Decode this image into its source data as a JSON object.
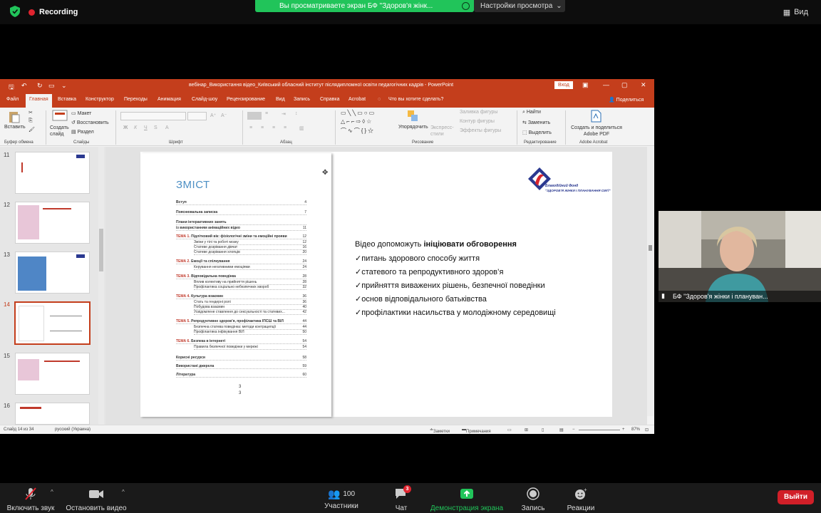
{
  "zoom": {
    "recording_label": "Recording",
    "share_banner": "Вы просматриваете экран БФ \"Здоров'я жінк...",
    "view_options": "Настройки просмотра",
    "view_button": "Вид"
  },
  "ppt": {
    "window_title": "вебінар_Використання відео_Київський обласний інститут післядипломної освіти педагогічних кадрів  -  PowerPoint",
    "signin": "Вход",
    "tabs": [
      "Файл",
      "Главная",
      "Вставка",
      "Конструктор",
      "Переходы",
      "Анимация",
      "Слайд-шоу",
      "Рецензирование",
      "Вид",
      "Запись",
      "Справка",
      "Acrobat"
    ],
    "tell_me": "Что вы хотите сделать?",
    "share": "Поделиться",
    "ribbon": {
      "paste": "Вставить",
      "new_slide": "Создать слайд",
      "layout": "Макет",
      "reset": "Восстановить",
      "section": "Раздел",
      "arrange": "Упорядочить",
      "quick_styles": "Экспресс-стили",
      "shape_fill": "Заливка фигуры",
      "shape_outline": "Контур фигуры",
      "shape_effects": "Эффекты фигуры",
      "find": "Найти",
      "replace": "Заменить",
      "select": "Выделить",
      "adobe": "Создать и поделиться Adobe PDF",
      "groups": [
        "Буфер обмена",
        "Слайды",
        "Шрифт",
        "Абзац",
        "Рисование",
        "Редактирование",
        "Adobe Acrobat"
      ]
    },
    "thumb_numbers": [
      "11",
      "12",
      "13",
      "14",
      "15",
      "16"
    ],
    "slide": {
      "toc_title": "ЗМІСТ",
      "toc": [
        {
          "label": "Вступ",
          "page": "4"
        },
        {
          "label": "Пояснювальна записка",
          "page": "7"
        },
        {
          "label": "Плани інтерактивних занять",
          "page": ""
        },
        {
          "label": "із використанням анімаційних відео",
          "page": "11"
        }
      ],
      "topics": [
        {
          "tema": "ТЕМА 1.",
          "title": "Підлітковий вік: фізіологічні зміни та емоційні прояви",
          "page": "12",
          "subs": [
            [
              "Зміни у тілі та роботі мозку",
              "12"
            ],
            [
              "Статеве дозрівання дівчат",
              "16"
            ],
            [
              "Статеве дозрівання хлопців",
              "20"
            ]
          ]
        },
        {
          "tema": "ТЕМА 2.",
          "title": "Емоції та спілкування",
          "page": "24",
          "subs": [
            [
              "Керування негативними емоціями",
              "24"
            ]
          ]
        },
        {
          "tema": "ТЕМА 3.",
          "title": "Відповідальна поведінка",
          "page": "28",
          "subs": [
            [
              "Вплив колективу на прийняття рішень",
              "28"
            ],
            [
              "Профілактика соціально небезпечних хвороб",
              "32"
            ]
          ]
        },
        {
          "tema": "ТЕМА 4.",
          "title": "Культура взаємин",
          "page": "36",
          "subs": [
            [
              "Стать та гендерні ролі",
              "36"
            ],
            [
              "Побудова взаємин",
              "40"
            ],
            [
              "Усвідомлене ставлення до сексуальності та статевих...",
              "42"
            ]
          ]
        },
        {
          "tema": "ТЕМА 5.",
          "title": "Репродуктивне здоров'я, профілактика ІПСШ та ВІЛ",
          "page": "44",
          "subs": [
            [
              "Безпечна статева поведінка: методи контрацепції",
              "44"
            ],
            [
              "Профілактика інфікування ВІЛ",
              "50"
            ]
          ]
        },
        {
          "tema": "ТЕМА 6.",
          "title": "Безпека в інтернеті",
          "page": "54",
          "subs": [
            [
              "Правила безпечної поведінки у мережі",
              "54"
            ]
          ]
        }
      ],
      "end_items": [
        {
          "label": "Корисні ресурси",
          "page": "58"
        },
        {
          "label": "Використані джерела",
          "page": "59"
        },
        {
          "label": "Література",
          "page": "60"
        }
      ],
      "page_numbers": [
        "3",
        "3"
      ],
      "intro_prefix": "Відео допоможуть ",
      "intro_bold": "ініціювати обговорення",
      "bullets": [
        "✓питань здорового способу життя",
        "✓статевого та репродуктивного здоров’я",
        "✓прийняття виважених рішень, безпечної поведінки",
        "✓основ відповідального батьківства",
        "✓профілактики насильства у молодіжному середовищі"
      ],
      "logo_line1": "Благодійний Фонд",
      "logo_line2": "\"ЗДОРОВ'Я ЖІНКИ І ПЛАНУВАННЯ СІМ'Ї\""
    },
    "status": {
      "slide_of": "Слайд 14 из 34",
      "language": "русский (Украина)",
      "notes": "Заметки",
      "comments": "Примечания",
      "zoom": "87%"
    }
  },
  "video": {
    "participant_name": "БФ \"Здоров'я жінки і плануван..."
  },
  "bottom": {
    "unmute": "Включить звук",
    "stop_video": "Остановить видео",
    "participants_count": "100",
    "participants": "Участники",
    "chat": "Чат",
    "chat_badge": "3",
    "share_screen": "Демонстрация экрана",
    "record": "Запись",
    "reactions": "Реакции",
    "leave": "Выйти"
  },
  "colors": {
    "ppt_accent": "#c43e1c",
    "zoom_green": "#21c45a",
    "leave_red": "#d11f28",
    "toc_title_blue": "#4c8fc4"
  }
}
